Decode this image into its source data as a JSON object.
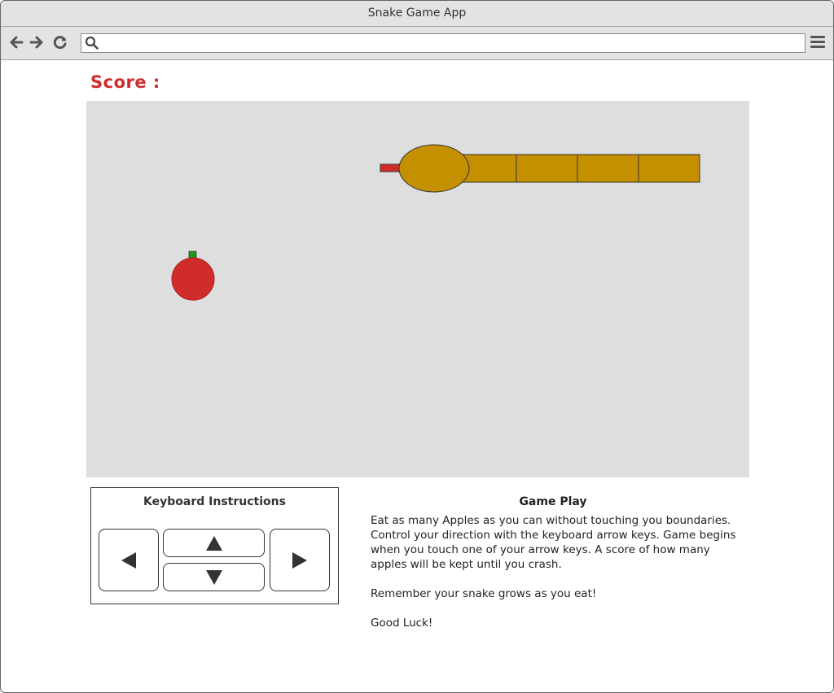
{
  "window": {
    "title": "Snake Game App"
  },
  "toolbar": {
    "back_icon": "arrow-left-icon",
    "forward_icon": "arrow-right-icon",
    "reload_icon": "reload-icon",
    "address_value": "",
    "menu_icon": "hamburger-menu-icon"
  },
  "score": {
    "label": "Score :"
  },
  "board": {
    "background": "#dedede",
    "snake_color": "#c49000",
    "tongue_color": "#d12c2c",
    "apple_color": "#d12c2c",
    "apple_stem_color": "#1a9a1a",
    "snake_body_segments": 4
  },
  "instructions": {
    "title": "Keyboard Instructions",
    "keys": [
      "left-arrow",
      "up-arrow",
      "down-arrow",
      "right-arrow"
    ]
  },
  "gameplay": {
    "title": "Game Play",
    "paragraphs": [
      "Eat as many Apples as you can without touching you boundaries. Control your direction with the keyboard arrow keys. Game begins when you touch one of your arrow keys. A score of how many apples will be kept until you crash.",
      "Remember your snake grows as you eat!",
      "Good Luck!"
    ]
  }
}
